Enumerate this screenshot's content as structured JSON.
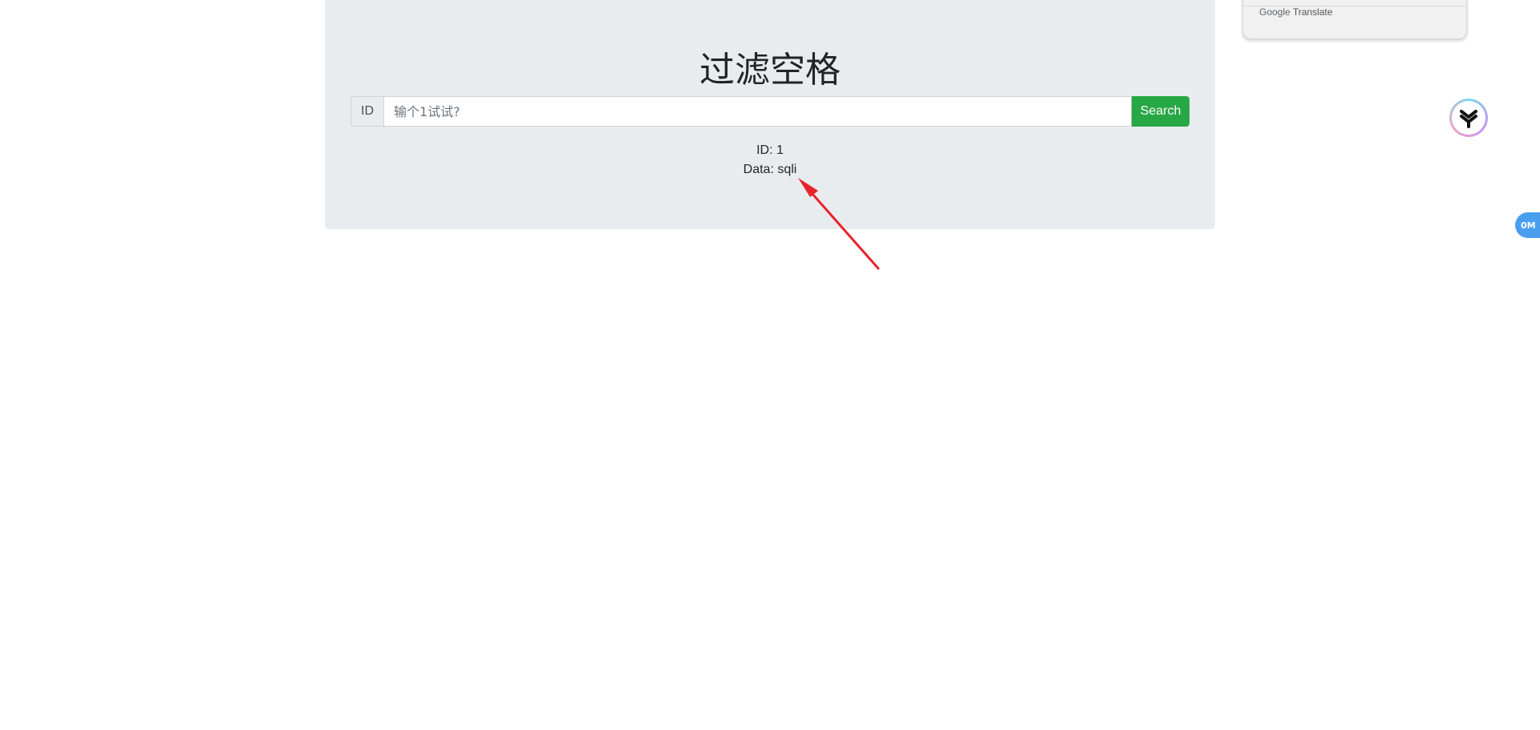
{
  "page": {
    "title": "过滤空格"
  },
  "search": {
    "prepend_label": "ID",
    "placeholder": "输个1试试?",
    "value": "",
    "button_label": "Search"
  },
  "results": {
    "id_line": "ID: 1",
    "data_line": "Data: sqli"
  },
  "translate_popup": {
    "brand_google": "Google",
    "brand_translate": "Translate"
  },
  "floating": {
    "logo_icon": "extension-logo-icon",
    "badge_text": "0M"
  },
  "colors": {
    "button": "#28a745",
    "jumbotron": "#e9ecef",
    "arrow": "#e8232a",
    "badge": "#4a9ef0"
  }
}
